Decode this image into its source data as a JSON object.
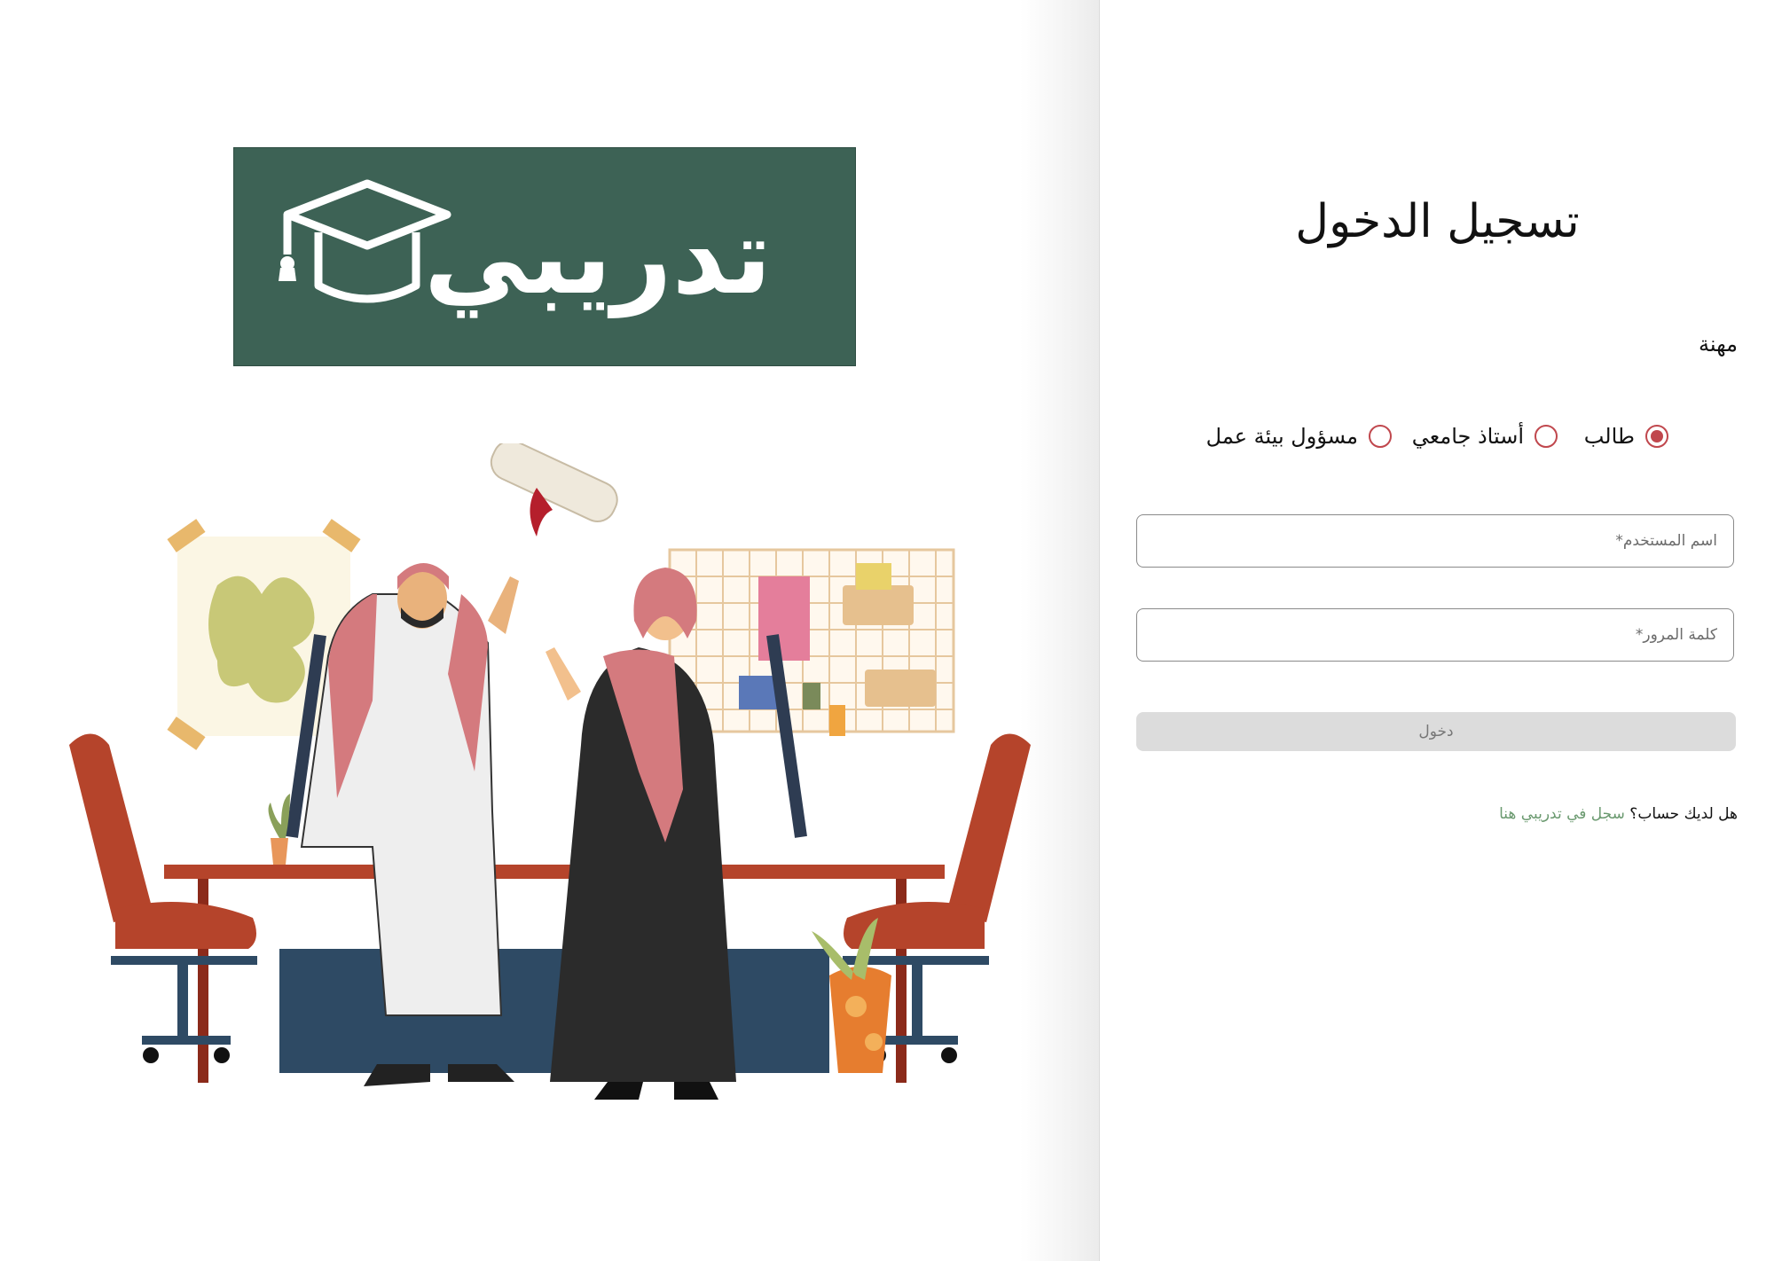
{
  "brand": {
    "logo_text": "تدريبي",
    "logo_bg": "#3d6255",
    "logo_icon": "graduation-cap-icon"
  },
  "login": {
    "title": "تسجيل الدخول",
    "role_label": "مهنة",
    "roles": [
      {
        "label": "طالب",
        "selected": true
      },
      {
        "label": "أستاذ جامعي",
        "selected": false
      },
      {
        "label": "مسؤول بيئة عمل",
        "selected": false
      }
    ],
    "username_placeholder": "اسم المستخدم*",
    "password_placeholder": "كلمة المرور*",
    "submit_label": "دخول",
    "register_prompt": "هل لديك حساب؟",
    "register_link": "سجل في تدريبي هنا"
  },
  "colors": {
    "accent": "#c0474d",
    "link": "#6b9a70",
    "button_disabled": "#dcdcdc"
  }
}
